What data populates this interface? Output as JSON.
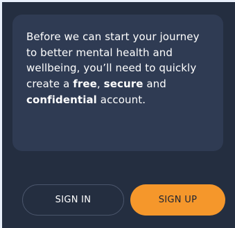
{
  "intro": {
    "text_1": "Before we can start your journey to better mental health and wellbeing, you’ll need to quickly create a ",
    "bold_1": "free",
    "text_2": ", ",
    "bold_2": "secure",
    "text_3": " and ",
    "bold_3": "confidential",
    "text_4": " account."
  },
  "actions": {
    "sign_in_label": "SIGN IN",
    "sign_up_label": "SIGN UP"
  },
  "colors": {
    "background": "#242e40",
    "card": "#2f3b53",
    "accent": "#f5972b",
    "outer_frame": "#e9f0fb"
  }
}
